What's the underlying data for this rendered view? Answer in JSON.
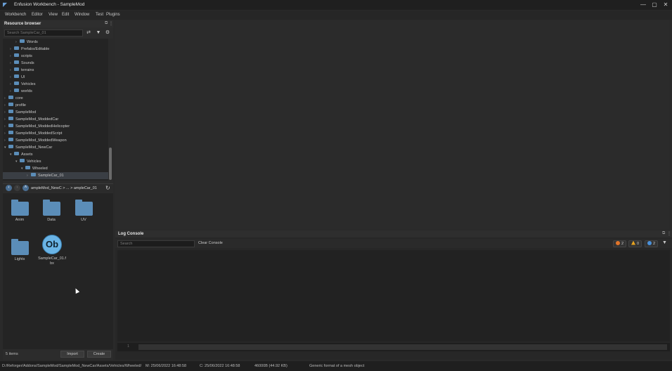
{
  "window": {
    "title": "Enfusion Workbench - SampleMod",
    "controls": [
      "—",
      "▢",
      "✕"
    ]
  },
  "menu": [
    "Workbench",
    "Editor",
    "View",
    "Edit",
    "Window",
    "Test",
    "Plugins"
  ],
  "resource_browser": {
    "title": "Resource browser",
    "search_placeholder": "Search SampleCar_01",
    "tree": [
      {
        "label": "Words",
        "depth": 2,
        "expanded": false
      },
      {
        "label": "Prefabs/Editable",
        "depth": 1,
        "expanded": false
      },
      {
        "label": "scripts",
        "depth": 1,
        "expanded": false
      },
      {
        "label": "Sounds",
        "depth": 1,
        "expanded": false
      },
      {
        "label": "terrains",
        "depth": 1,
        "expanded": false
      },
      {
        "label": "UI",
        "depth": 1,
        "expanded": false
      },
      {
        "label": "Vehicles",
        "depth": 1,
        "expanded": false
      },
      {
        "label": "worlds",
        "depth": 1,
        "expanded": false
      },
      {
        "label": "core",
        "depth": 0,
        "expanded": false
      },
      {
        "label": "profile",
        "depth": 0,
        "expanded": false
      },
      {
        "label": "SampleMod",
        "depth": 0,
        "expanded": false
      },
      {
        "label": "SampleMod_ModdedCar",
        "depth": 0,
        "expanded": false
      },
      {
        "label": "SampleMod_ModdedHelicopter",
        "depth": 0,
        "expanded": false
      },
      {
        "label": "SampleMod_ModdedScript",
        "depth": 0,
        "expanded": false
      },
      {
        "label": "SampleMod_ModdedWeapon",
        "depth": 0,
        "expanded": false
      },
      {
        "label": "SampleMod_NewCar",
        "depth": 0,
        "expanded": true
      },
      {
        "label": "Assets",
        "depth": 1,
        "expanded": true
      },
      {
        "label": "Vehicles",
        "depth": 2,
        "expanded": true
      },
      {
        "label": "Wheeled",
        "depth": 3,
        "expanded": true
      },
      {
        "label": "SampleCar_01",
        "depth": 4,
        "expanded": false,
        "selected": true
      }
    ],
    "breadcrumb": "ampleMod_NewC > ... > ampleCar_01",
    "assets": [
      {
        "label": "Anim",
        "kind": "folder"
      },
      {
        "label": "Data",
        "kind": "folder"
      },
      {
        "label": "UV",
        "kind": "folder"
      },
      {
        "label": "Lights",
        "kind": "folder"
      },
      {
        "label": "SampleCar_01.f bx",
        "kind": "object",
        "badge": "Ob"
      }
    ],
    "item_count": "5 items",
    "import_label": "Import",
    "create_label": "Create"
  },
  "log_console": {
    "title": "Log Console",
    "search_placeholder": "Search",
    "clear_label": "Clear Console",
    "counters": [
      {
        "name": "errors",
        "value": "2",
        "color": "#e0742a"
      },
      {
        "name": "warnings",
        "value": "0",
        "color": "#e6a21f"
      },
      {
        "name": "info",
        "value": "2",
        "color": "#4a90d9"
      }
    ],
    "line_number": "1"
  },
  "status": {
    "path": "D:/Reforger/Addons/SampleMod/SampleMod_NewCar/Assets/Vehicles/Wheeled/",
    "modified": "M: 25/06/2022 16:48:58",
    "created": "C: 25/06/2022 16:48:58",
    "size": "46000B (44.92 KB)",
    "hint": "Generic format of a mesh object"
  }
}
